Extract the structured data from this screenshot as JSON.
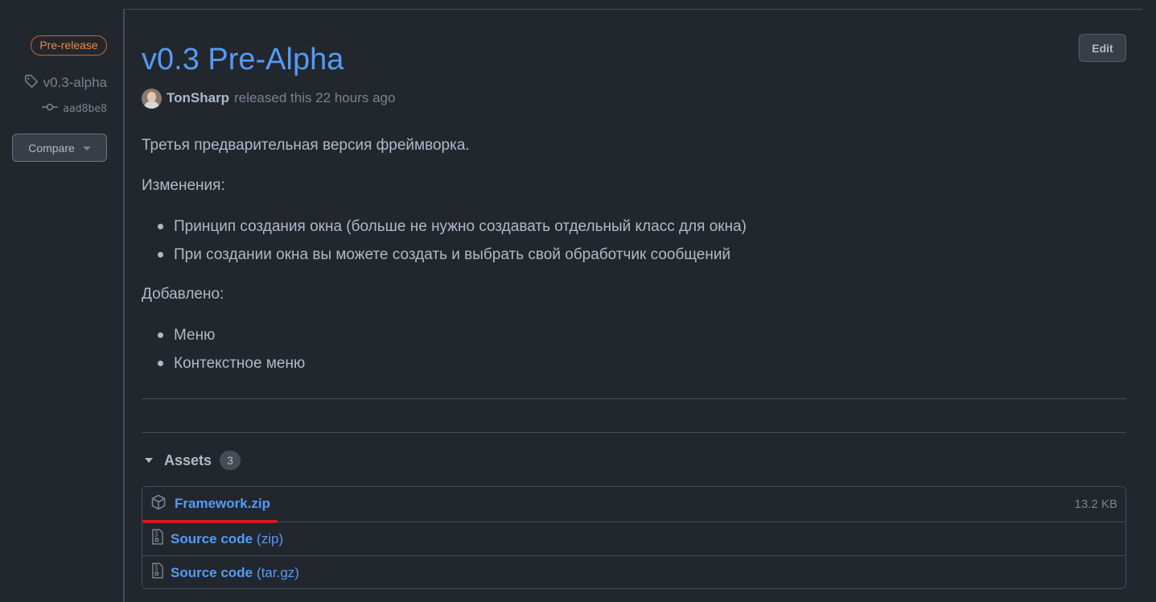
{
  "sidebar": {
    "prerelease_label": "Pre-release",
    "tag_name": "v0.3-alpha",
    "commit_sha": "aad8be8",
    "compare_label": "Compare"
  },
  "header": {
    "title": "v0.3 Pre-Alpha",
    "edit_label": "Edit",
    "author": "TonSharp",
    "released_text": "released this 22 hours ago"
  },
  "body": {
    "intro": "Третья предварительная версия фреймворка.",
    "changes_heading": "Изменения:",
    "changes": [
      "Принцип создания окна (больше не нужно создавать отдельный класс для окна)",
      "При создании окна вы можете создать и выбрать свой обработчик сообщений"
    ],
    "added_heading": "Добавлено:",
    "added": [
      "Меню",
      "Контекстное меню"
    ]
  },
  "assets": {
    "label": "Assets",
    "count": "3",
    "items": [
      {
        "name": "Framework.zip",
        "ext": "",
        "size": "13.2 KB",
        "icon": "package-icon"
      },
      {
        "name": "Source code",
        "ext": "(zip)",
        "size": "",
        "icon": "file-zip-icon"
      },
      {
        "name": "Source code",
        "ext": "(tar.gz)",
        "size": "",
        "icon": "file-zip-icon"
      }
    ]
  },
  "colors": {
    "background": "#22272e",
    "link": "#539bf5",
    "prerelease": "#f0883e",
    "annotation": "#d11b1b"
  }
}
